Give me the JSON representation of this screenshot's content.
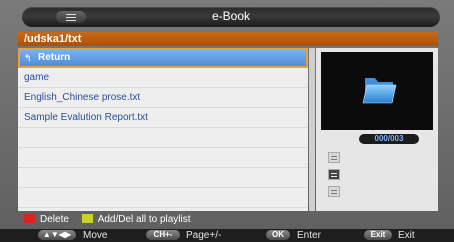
{
  "header": {
    "title": "e-Book"
  },
  "path": "/udska1/txt",
  "files": [
    {
      "label": "Return",
      "selected": true
    },
    {
      "label": "game"
    },
    {
      "label": "English_Chinese prose.txt"
    },
    {
      "label": "Sample Evalution Report.txt"
    },
    {
      "label": ""
    },
    {
      "label": ""
    },
    {
      "label": ""
    },
    {
      "label": ""
    }
  ],
  "preview": {
    "counter": "000/003"
  },
  "legend": {
    "red_label": "Delete",
    "yellow_label": "Add/Del all to playlist"
  },
  "controls": {
    "move_key": "▲▼◀▶",
    "move_label": "Move",
    "page_key": "CH+-",
    "page_label": "Page+/-",
    "ok_key": "OK",
    "ok_label": "Enter",
    "exit_key": "Exit",
    "exit_label": "Exit"
  },
  "colors": {
    "accent_orange": "#c96a18",
    "selection_blue": "#4d8ad6",
    "red": "#e02020",
    "yellow": "#c9d22a"
  }
}
